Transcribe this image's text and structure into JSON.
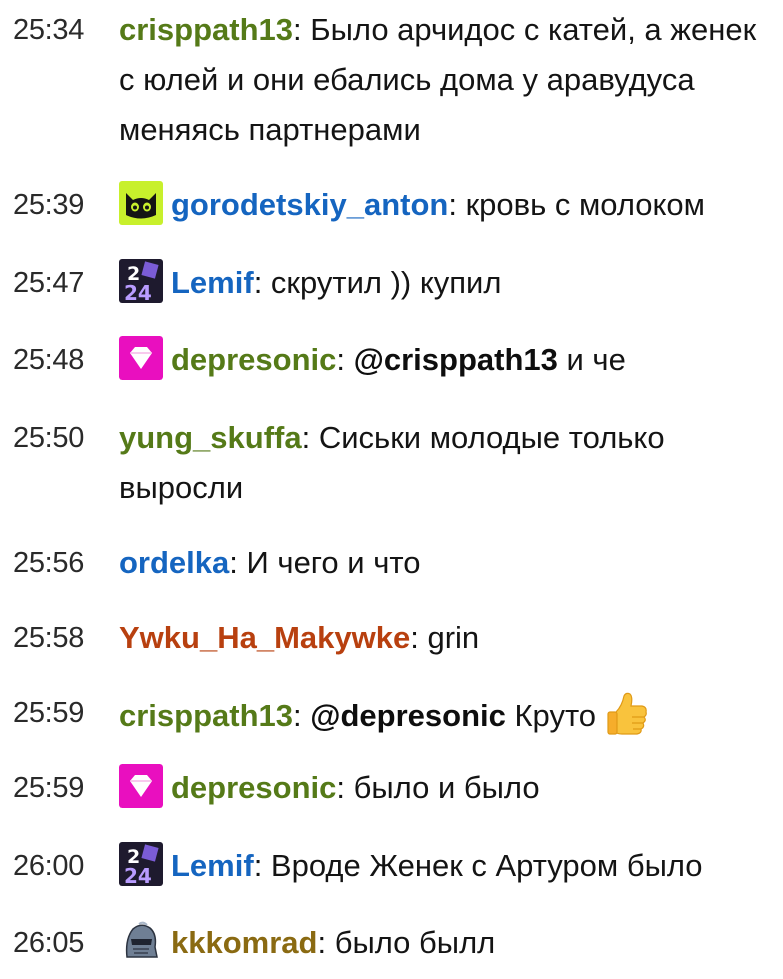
{
  "colors": {
    "olive": "#557a18",
    "blue": "#1565c0",
    "rust": "#b8400f",
    "brown": "#8a6a12",
    "text": "#141414"
  },
  "messages": [
    {
      "time": "25:34",
      "user": "crisppath13",
      "sep": ":",
      "text": " Было арчидос с катей, а женек с юлей и они ебались дома у аравудуса меняясь партнерами"
    },
    {
      "time": "25:39",
      "badge": "cat-badge-icon",
      "user": "gorodetskiy_anton",
      "sep": ":",
      "text": " кровь с молоком"
    },
    {
      "time": "25:47",
      "badge": "2024-badge-icon",
      "user": "Lemif",
      "sep": ":",
      "text": " скрутил )) купил"
    },
    {
      "time": "25:48",
      "badge": "gem-badge-icon",
      "user": "depresonic",
      "sep": ":",
      "mention": "@crisppath13",
      "text": " и че"
    },
    {
      "time": "25:50",
      "user": "yung_skuffa",
      "sep": ":",
      "text": " Сиськи молодые только выросли"
    },
    {
      "time": "25:56",
      "user": "ordelka",
      "sep": ":",
      "text": " И чего и что"
    },
    {
      "time": "25:58",
      "user": "Ywku_Ha_Makywke",
      "sep": ":",
      "text": " grin"
    },
    {
      "time": "25:59",
      "user": "crisppath13",
      "sep": ":",
      "mention": "@depresonic",
      "text": " Круто",
      "emoji": "thumbs-up-emoji"
    },
    {
      "time": "25:59",
      "badge": "gem-badge-icon",
      "user": "depresonic",
      "sep": ":",
      "text": " было и было"
    },
    {
      "time": "26:00",
      "badge": "2024-badge-icon",
      "user": "Lemif",
      "sep": ":",
      "text": " Вроде Женек с Артуром было"
    },
    {
      "time": "26:05",
      "badge": "knight-badge-icon",
      "user": "kkkomrad",
      "sep": ":",
      "text": " было былл"
    }
  ]
}
